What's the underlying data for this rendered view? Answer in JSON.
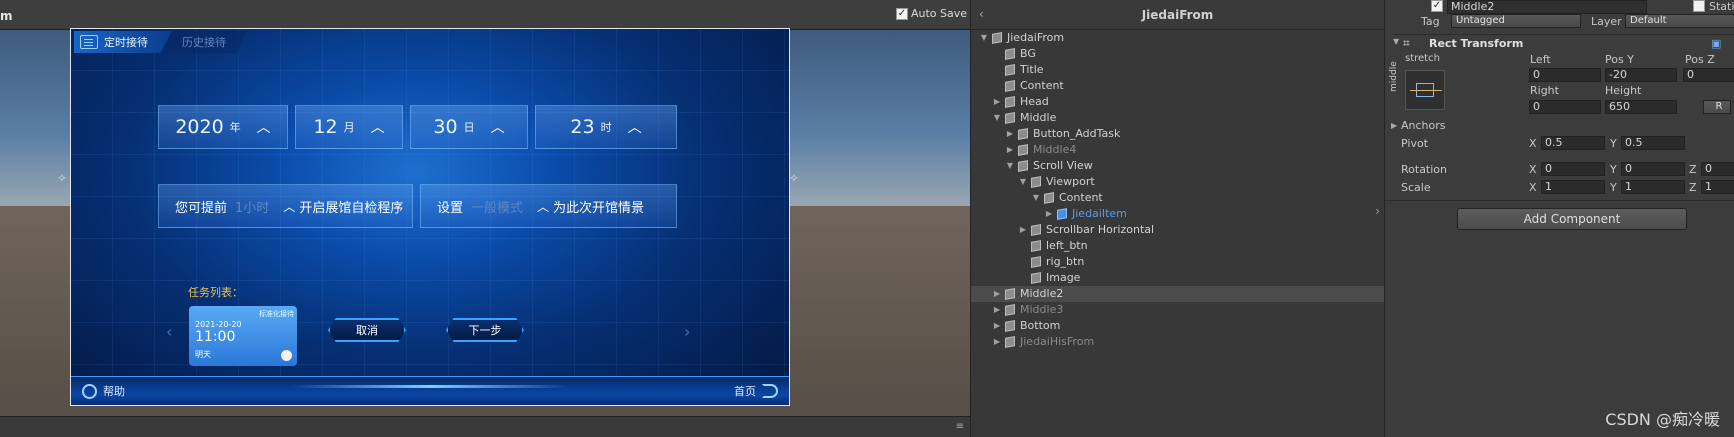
{
  "game": {
    "title": "m",
    "autosave_label": "Auto Save",
    "autosave_checked": "✓",
    "menu_glyph": "≡",
    "tabs": [
      {
        "label": "定时接待"
      },
      {
        "label": "历史接待"
      }
    ],
    "date": [
      {
        "num": "2020",
        "unit": "年"
      },
      {
        "num": "12",
        "unit": "月"
      },
      {
        "num": "30",
        "unit": "日"
      },
      {
        "num": "23",
        "unit": "时"
      }
    ],
    "info_left": {
      "prefix": "您可提前",
      "value": "1小时",
      "suffix": "开启展馆自检程序"
    },
    "info_right": {
      "prefix": "设置",
      "value": "一般模式",
      "suffix": "为此次开馆情景"
    },
    "task_label": "任务列表：",
    "task_card": {
      "badge": "标准化接待",
      "date": "2021-20-20",
      "time": "11:00",
      "day": "明天"
    },
    "cancel_label": "取消",
    "next_label": "下一步",
    "help_label": "帮助",
    "home_label": "首页"
  },
  "hierarchy": {
    "title": "JiedaiFrom",
    "items": [
      {
        "label": "JiedaiFrom",
        "state": "expanded"
      },
      {
        "label": "BG"
      },
      {
        "label": "Title"
      },
      {
        "label": "Content"
      },
      {
        "label": "Head",
        "state": "collapsed"
      },
      {
        "label": "Middle",
        "state": "expanded"
      },
      {
        "label": "Button_AddTask",
        "state": "collapsed"
      },
      {
        "label": "Middle4",
        "state": "collapsed",
        "dim": true
      },
      {
        "label": "Scroll View",
        "state": "expanded"
      },
      {
        "label": "Viewport",
        "state": "expanded"
      },
      {
        "label": "Content",
        "state": "expanded"
      },
      {
        "label": "JiedaiItem",
        "state": "collapsed",
        "prefab": true
      },
      {
        "label": "Scrollbar Horizontal",
        "state": "collapsed"
      },
      {
        "label": "left_btn"
      },
      {
        "label": "rig_btn"
      },
      {
        "label": "Image"
      },
      {
        "label": "Middle2",
        "state": "collapsed",
        "selected": true
      },
      {
        "label": "Middle3",
        "state": "collapsed",
        "dim": true
      },
      {
        "label": "Bottom",
        "state": "collapsed"
      },
      {
        "label": "JiedaiHisFrom",
        "state": "collapsed",
        "dim": true
      }
    ]
  },
  "inspector": {
    "object_name": "Middle2",
    "static_label": "Stati",
    "tag_label": "Tag",
    "tag_value": "Untagged",
    "layer_label": "Layer",
    "layer_value": "Default",
    "component_title": "Rect Transform",
    "anchor_h": "stretch",
    "anchor_v": "middle",
    "cols1": [
      "Left",
      "Pos Y",
      "Pos Z"
    ],
    "vals1": [
      "0",
      "-20",
      "0"
    ],
    "cols2": [
      "Right",
      "Height"
    ],
    "vals2": [
      "0",
      "650"
    ],
    "raw_button": "R",
    "anchors_label": "Anchors",
    "pivot_label": "Pivot",
    "pivot": {
      "x": "0.5",
      "y": "0.5"
    },
    "rotation_label": "Rotation",
    "rotation": {
      "x": "0",
      "y": "0",
      "z": "0"
    },
    "scale_label": "Scale",
    "scale": {
      "x": "1",
      "y": "1",
      "z": "1"
    },
    "add_component": "Add Component",
    "watermark": "CSDN @痴冷暖"
  }
}
